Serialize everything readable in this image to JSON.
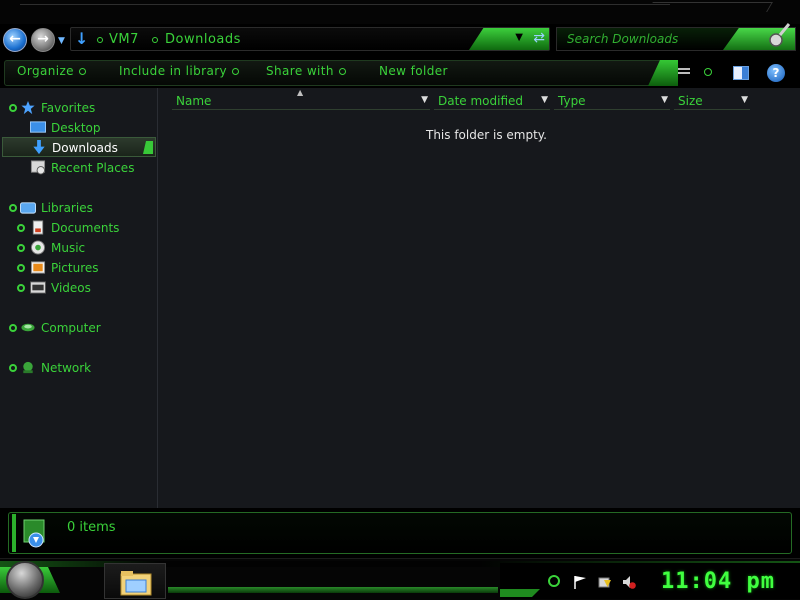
{
  "address_bar": {
    "breadcrumbs": [
      "VM7",
      "Downloads"
    ],
    "search_placeholder": "Search Downloads"
  },
  "toolbar": {
    "organize": "Organize",
    "include_in_library": "Include in library",
    "share_with": "Share with",
    "new_folder": "New folder",
    "help_glyph": "?"
  },
  "nav_pane": {
    "favorites": {
      "label": "Favorites",
      "items": [
        {
          "label": "Desktop",
          "icon": "desktop-icon"
        },
        {
          "label": "Downloads",
          "icon": "downloads-icon",
          "selected": true
        },
        {
          "label": "Recent Places",
          "icon": "recent-places-icon"
        }
      ]
    },
    "libraries": {
      "label": "Libraries",
      "items": [
        {
          "label": "Documents",
          "icon": "documents-icon"
        },
        {
          "label": "Music",
          "icon": "music-icon"
        },
        {
          "label": "Pictures",
          "icon": "pictures-icon"
        },
        {
          "label": "Videos",
          "icon": "videos-icon"
        }
      ]
    },
    "computer": {
      "label": "Computer"
    },
    "network": {
      "label": "Network"
    }
  },
  "columns": [
    "Name",
    "Date modified",
    "Type",
    "Size"
  ],
  "content": {
    "empty_message": "This folder is empty."
  },
  "details": {
    "item_count": "0 items"
  },
  "taskbar": {
    "clock": "11:04 pm"
  },
  "colors": {
    "accent": "#3ad23a",
    "background": "#16181c",
    "selected_text": "#ffffff"
  }
}
